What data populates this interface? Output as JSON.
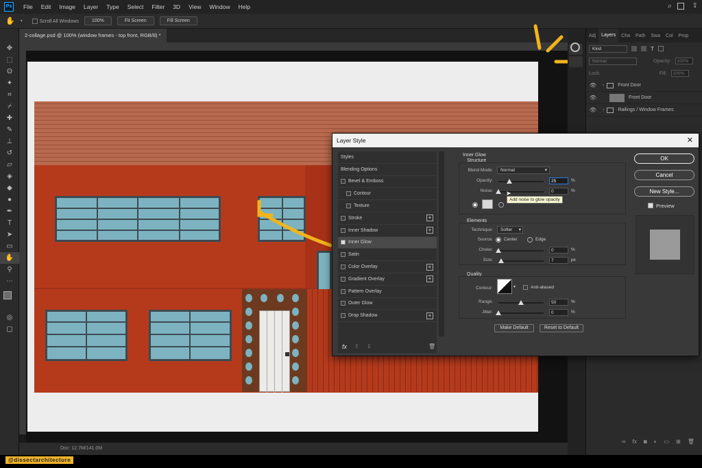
{
  "app": {
    "logo": "Ps"
  },
  "menu": [
    "File",
    "Edit",
    "Image",
    "Layer",
    "Type",
    "Select",
    "Filter",
    "3D",
    "View",
    "Window",
    "Help"
  ],
  "options": {
    "scroll_all": "Scroll All Windows",
    "zoom": "100%",
    "fit_screen": "Fit Screen",
    "fill_screen": "Fill Screen"
  },
  "document": {
    "tab_title": "2-collage.psd @ 100% (window frames - top front, RGB/8) *",
    "status": "Doc: 12.7M/141.0M"
  },
  "layers_panel": {
    "tabs": [
      "Adj",
      "Layers",
      "Cha",
      "Path",
      "Swa",
      "Col",
      "Prop"
    ],
    "search_placeholder": "Kind",
    "blend_mode": "Normal",
    "opacity_label": "Opacity:",
    "opacity_value": "100%",
    "lock_label": "Lock:",
    "fill_label": "Fill:",
    "fill_value": "100%",
    "rows": [
      {
        "name": "Front Door",
        "type": "group"
      },
      {
        "name": "Front Door",
        "type": "layer"
      },
      {
        "name": "Railings / Window Frames",
        "type": "group"
      }
    ]
  },
  "dialog": {
    "title": "Layer Style",
    "styles_list": [
      {
        "label": "Styles",
        "checkbox": false,
        "checked": false,
        "plus": false,
        "indent": false,
        "selected": false
      },
      {
        "label": "Blending Options",
        "checkbox": false,
        "checked": false,
        "plus": false,
        "indent": false,
        "selected": false
      },
      {
        "label": "Bevel & Emboss",
        "checkbox": true,
        "checked": false,
        "plus": false,
        "indent": false,
        "selected": false
      },
      {
        "label": "Contour",
        "checkbox": true,
        "checked": false,
        "plus": false,
        "indent": true,
        "selected": false
      },
      {
        "label": "Texture",
        "checkbox": true,
        "checked": false,
        "plus": false,
        "indent": true,
        "selected": false
      },
      {
        "label": "Stroke",
        "checkbox": true,
        "checked": false,
        "plus": true,
        "indent": false,
        "selected": false
      },
      {
        "label": "Inner Shadow",
        "checkbox": true,
        "checked": false,
        "plus": true,
        "indent": false,
        "selected": false
      },
      {
        "label": "Inner Glow",
        "checkbox": true,
        "checked": true,
        "plus": false,
        "indent": false,
        "selected": true
      },
      {
        "label": "Satin",
        "checkbox": true,
        "checked": false,
        "plus": false,
        "indent": false,
        "selected": false
      },
      {
        "label": "Color Overlay",
        "checkbox": true,
        "checked": false,
        "plus": true,
        "indent": false,
        "selected": false
      },
      {
        "label": "Gradient Overlay",
        "checkbox": true,
        "checked": false,
        "plus": true,
        "indent": false,
        "selected": false
      },
      {
        "label": "Pattern Overlay",
        "checkbox": true,
        "checked": false,
        "plus": false,
        "indent": false,
        "selected": false
      },
      {
        "label": "Outer Glow",
        "checkbox": true,
        "checked": false,
        "plus": false,
        "indent": false,
        "selected": false
      },
      {
        "label": "Drop Shadow",
        "checkbox": true,
        "checked": false,
        "plus": true,
        "indent": false,
        "selected": false
      }
    ],
    "fx_label": "fx",
    "inner_glow": {
      "title": "Inner Glow",
      "structure_title": "Structure",
      "blend_mode_label": "Blend Mode:",
      "blend_mode_value": "Normal",
      "opacity_label": "Opacity:",
      "opacity_value": "25",
      "noise_label": "Noise:",
      "noise_value": "0",
      "percent": "%",
      "px": "px",
      "tooltip": "Add noise to glow opacity",
      "elements_title": "Elements",
      "technique_label": "Technique:",
      "technique_value": "Softer",
      "source_label": "Source:",
      "source_center": "Center",
      "source_edge": "Edge",
      "choke_label": "Choke:",
      "choke_value": "0",
      "size_label": "Size:",
      "size_value": "7",
      "quality_title": "Quality",
      "contour_label": "Contour:",
      "anti_aliased": "Anti-aliased",
      "range_label": "Range:",
      "range_value": "50",
      "jitter_label": "Jitter:",
      "jitter_value": "0",
      "make_default": "Make Default",
      "reset_default": "Reset to Default"
    },
    "buttons": {
      "ok": "OK",
      "cancel": "Cancel",
      "new_style": "New Style...",
      "preview": "Preview"
    }
  },
  "watermark": "@dissectarchitecture",
  "colors": {
    "annotation": "#f2b41b",
    "brick_wall": "#b53a1c",
    "window_glass": "#7db3c0"
  }
}
